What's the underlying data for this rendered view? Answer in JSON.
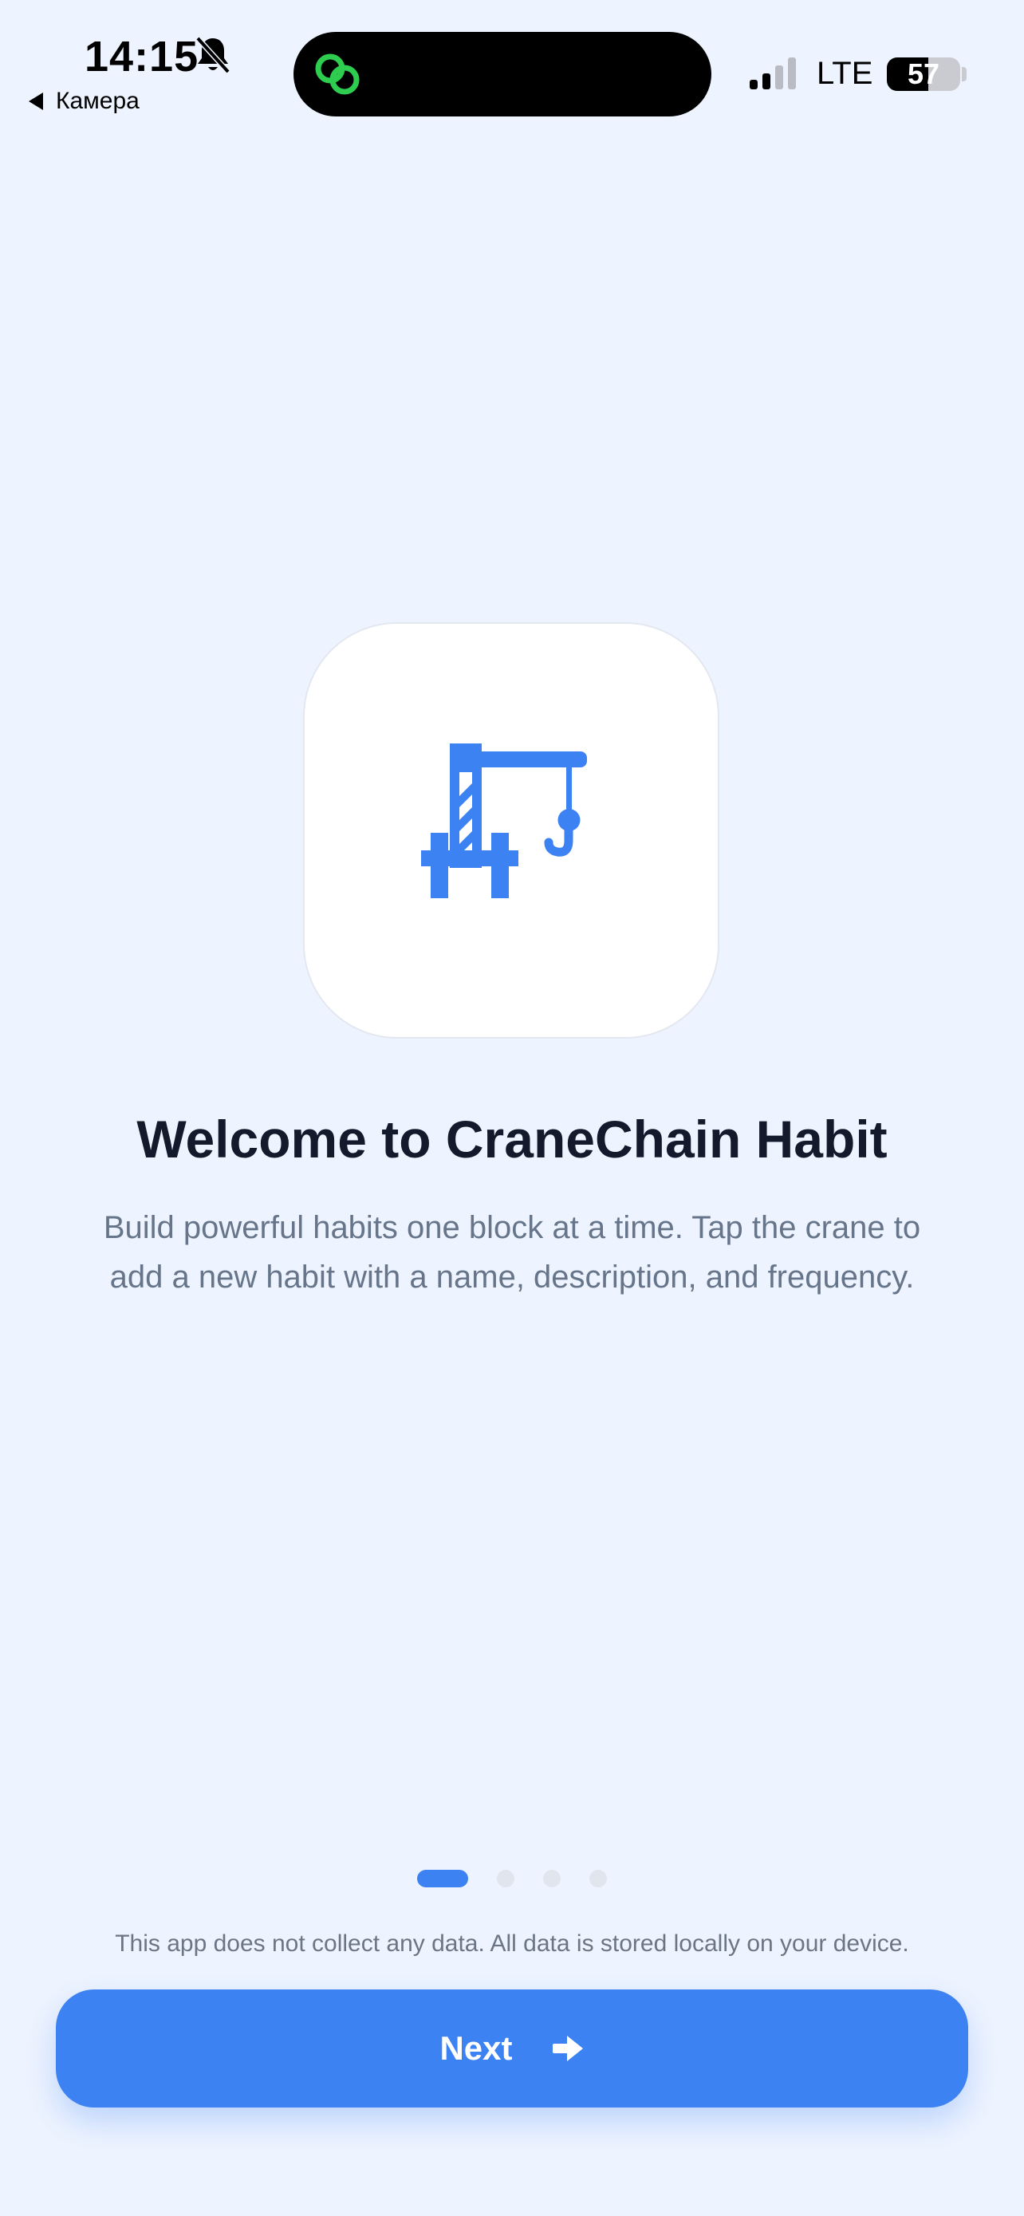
{
  "status_bar": {
    "time": "14:15",
    "back_label": "Камера",
    "network": "LTE",
    "battery_level": "57",
    "battery_percent": 57,
    "icons": [
      "bell-slash-icon",
      "link-icon",
      "signal-icon",
      "battery-icon"
    ]
  },
  "onboarding": {
    "logo_icon": "crane-icon",
    "title": "Welcome to CraneChain Habit",
    "description": "Build powerful habits one block at a time. Tap the crane to add a new habit with a name, description, and frequency.",
    "page_indicator": {
      "current": 1,
      "total": 4
    },
    "privacy_note": "This app does not collect any data. All data is stored locally on your device.",
    "next_label": "Next",
    "next_icon": "arrow-right-icon"
  },
  "colors": {
    "accent": "#3d82f2",
    "background": "#eef4ff",
    "title": "#131a2c",
    "body_text": "#66758a",
    "island_accent": "#2ecc4f"
  }
}
